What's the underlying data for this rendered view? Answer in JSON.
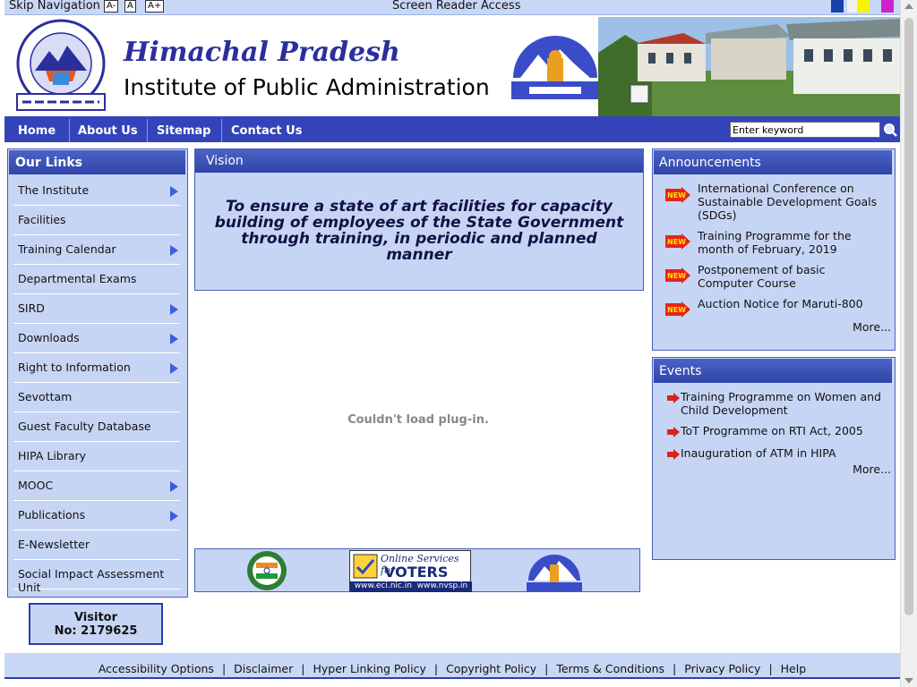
{
  "topbar": {
    "skip": "Skip Navigation",
    "font_small": "A-",
    "font_normal": "A",
    "font_large": "A+",
    "screen_reader": "Screen Reader Access",
    "theme_colors": [
      "#1a40b0",
      "#f0f0f0",
      "#f5f500",
      "#cc22cc"
    ]
  },
  "header": {
    "title_line1": "Himachal Pradesh",
    "title_line2": "Institute of Public Administration"
  },
  "nav": {
    "items": [
      "Home",
      "About Us",
      "Sitemap",
      "Contact Us"
    ],
    "search_placeholder": "Enter keyword"
  },
  "our_links": {
    "title": "Our Links",
    "items": [
      {
        "label": "The Institute",
        "submenu": true
      },
      {
        "label": "Facilities",
        "submenu": false
      },
      {
        "label": "Training Calendar",
        "submenu": true
      },
      {
        "label": "Departmental Exams",
        "submenu": false
      },
      {
        "label": "SIRD",
        "submenu": true
      },
      {
        "label": "Downloads",
        "submenu": true
      },
      {
        "label": "Right to Information",
        "submenu": true
      },
      {
        "label": "Sevottam",
        "submenu": false
      },
      {
        "label": "Guest Faculty Database",
        "submenu": false
      },
      {
        "label": "HIPA Library",
        "submenu": false
      },
      {
        "label": "MOOC",
        "submenu": true
      },
      {
        "label": "Publications",
        "submenu": true
      },
      {
        "label": "E-Newsletter",
        "submenu": false
      },
      {
        "label": "Social Impact Assessment Unit",
        "submenu": false
      }
    ]
  },
  "visitor": {
    "label": "Visitor",
    "count": "No: 2179625"
  },
  "vision": {
    "title": "Vision",
    "text": "To ensure a state of art facilities for capacity building of employees of the State Government through training, in periodic and planned manner"
  },
  "plugin_message": "Couldn't load plug-in.",
  "banners": {
    "voters_line1": "Online Services for",
    "voters_line2": "VOTERS",
    "voters_url": "www.eci.nic.in  www.nvsp.in"
  },
  "announcements": {
    "title": "Announcements",
    "badge": "NEW",
    "items": [
      "International Conference on Sustainable Development Goals (SDGs)",
      "Training Programme for the month of February, 2019",
      "Postponement of basic Computer Course",
      "Auction Notice for Maruti-800"
    ],
    "more": "More..."
  },
  "events": {
    "title": "Events",
    "items": [
      "Training Programme on Women and Child Development",
      "ToT Programme on RTI Act, 2005",
      "Inauguration of ATM in HIPA"
    ],
    "more": "More..."
  },
  "footer": {
    "links": [
      "Accessibility Options",
      "Disclaimer",
      "Hyper Linking Policy",
      "Copyright Policy",
      "Terms & Conditions",
      "Privacy Policy",
      "Help"
    ]
  }
}
